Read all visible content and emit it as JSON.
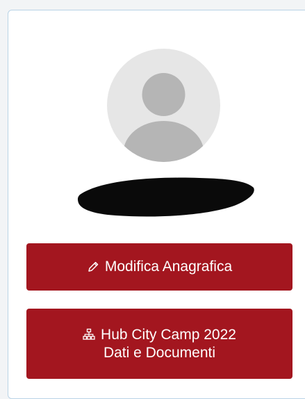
{
  "profile": {
    "avatar_icon": "default-user-avatar-icon",
    "name_redacted": true
  },
  "buttons": {
    "edit": {
      "icon": "pencil-icon",
      "label": "Modifica Anagrafica"
    },
    "hub": {
      "icon": "sitemap-icon",
      "label_line1": "Hub City Camp 2022",
      "label_line2": "Dati e Documenti"
    }
  },
  "colors": {
    "accent": "#a3161f",
    "card_border": "#b9d3e6",
    "avatar_bg": "#e6e6e6",
    "avatar_figure": "#b5b5b5"
  }
}
